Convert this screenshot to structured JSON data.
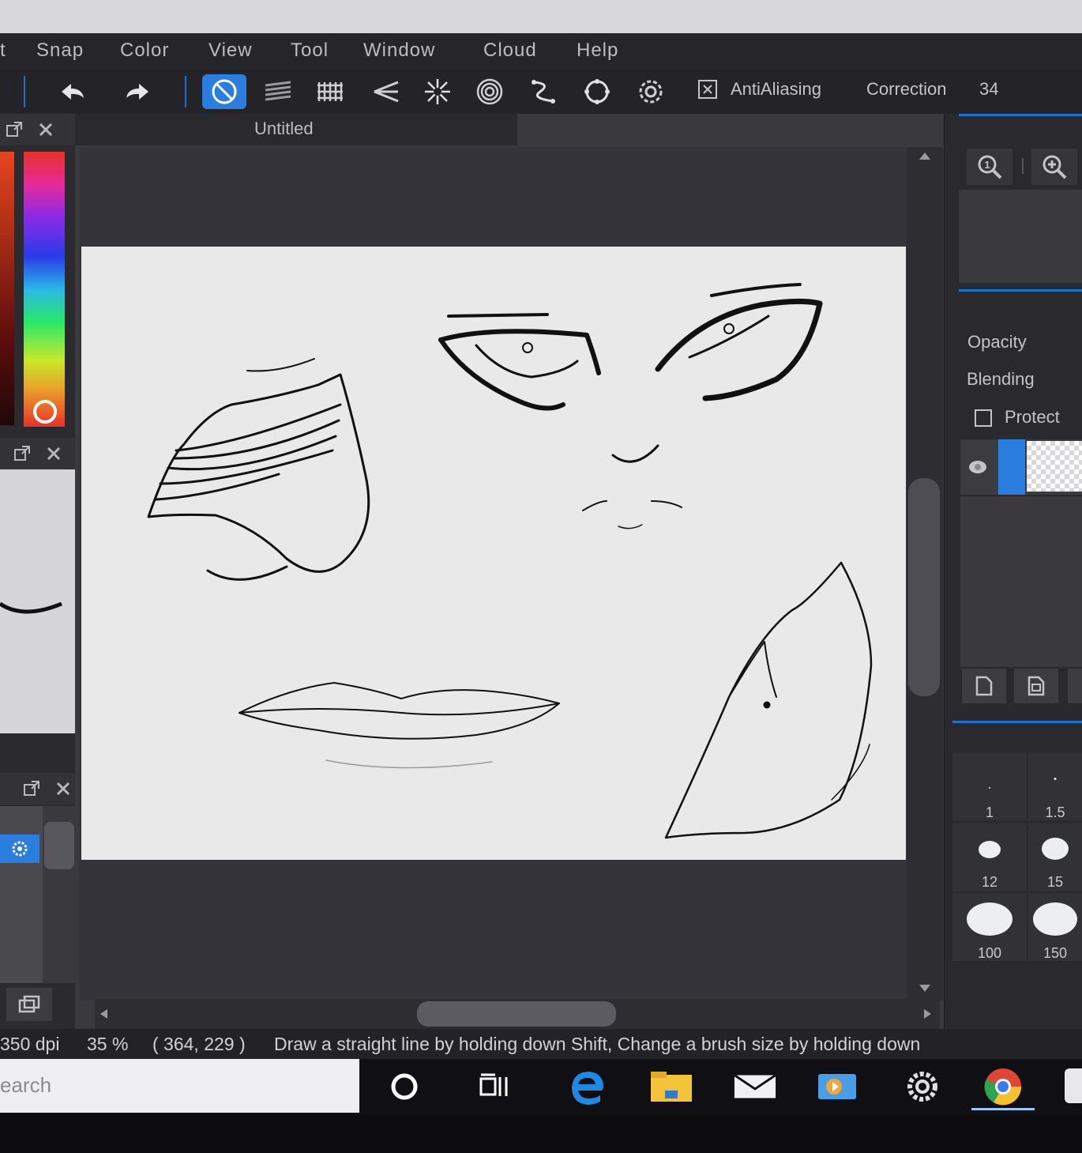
{
  "menu": [
    "t",
    "Snap",
    "Color",
    "View",
    "Tool",
    "Window",
    "Cloud",
    "Help"
  ],
  "toolbar": {
    "icons": [
      "undo-icon",
      "redo-icon",
      "snap-off-icon",
      "parallel-snap-icon",
      "grid-snap-icon",
      "vanishing-point-icon",
      "radial-snap-icon",
      "concentric-snap-icon",
      "curve-snap-icon",
      "circle-snap-icon",
      "settings-icon"
    ],
    "antialiasing_label": "AntiAliasing",
    "correction_label": "Correction",
    "correction_value": "34"
  },
  "document": {
    "title": "Untitled"
  },
  "right_panel": {
    "opacity_label": "Opacity",
    "blending_label": "Blending",
    "protect_label": "Protect"
  },
  "brush_sizes": [
    "1",
    "1.5",
    "12",
    "15",
    "100",
    "150"
  ],
  "status": {
    "dpi": "350 dpi",
    "zoom": "35 %",
    "coords": "( 364, 229 )",
    "hint": "Draw a straight line by holding down Shift, Change a brush size by holding down"
  },
  "taskbar": {
    "search_placeholder": "earch",
    "apps": [
      "cortana-icon",
      "task-view-icon",
      "edge-icon",
      "file-explorer-icon",
      "mail-icon",
      "media-icon",
      "settings-icon",
      "chrome-icon"
    ]
  },
  "colors": {
    "accent": "#2c7de0",
    "panel": "#2a292d",
    "canvas_bg": "#35343a",
    "paper": "#e9e9ea"
  }
}
